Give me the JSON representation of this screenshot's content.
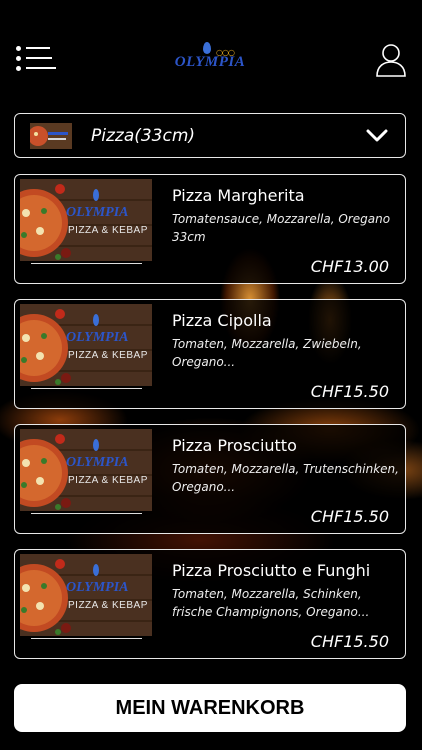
{
  "header": {
    "logo_text": "OLYMPIA",
    "menu_icon": "menu-icon",
    "user_icon": "user-icon"
  },
  "category": {
    "label": "Pizza(33cm)",
    "chevron_icon": "chevron-down-icon"
  },
  "products": [
    {
      "name": "Pizza Margherita",
      "description": "Tomatensauce, Mozzarella, Oregano 33cm",
      "price": "CHF13.00",
      "image_logo": "OLYMPIA",
      "image_subtitle": "PIZZA & KEBAP"
    },
    {
      "name": "Pizza Cipolla",
      "description": "Tomaten, Mozzarella, Zwiebeln, Oregano...",
      "price": "CHF15.50",
      "image_logo": "OLYMPIA",
      "image_subtitle": "PIZZA & KEBAP"
    },
    {
      "name": "Pizza Prosciutto",
      "description": "Tomaten, Mozzarella, Trutenschinken, Oregano...",
      "price": "CHF15.50",
      "image_logo": "OLYMPIA",
      "image_subtitle": "PIZZA & KEBAP"
    },
    {
      "name": "Pizza Prosciutto e Funghi",
      "description": "Tomaten, Mozzarella, Schinken, frische Champignons, Oregano...",
      "price": "CHF15.50",
      "image_logo": "OLYMPIA",
      "image_subtitle": "PIZZA & KEBAP"
    }
  ],
  "cart_button": {
    "label": "MEIN WARENKORB"
  },
  "colors": {
    "background": "#000000",
    "logo_blue": "#2c55c8",
    "border": "#e8e8e8",
    "button": "#ffffff"
  }
}
